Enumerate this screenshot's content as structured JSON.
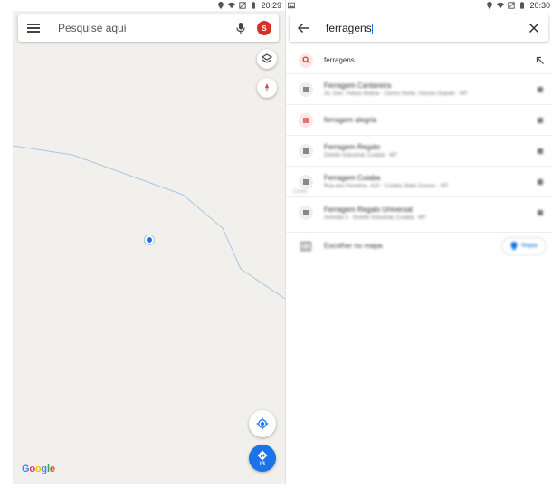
{
  "left_screen": {
    "status_time": "20:29",
    "search_placeholder": "Pesquise aqui",
    "avatar_letter": "S",
    "go_button_label": "IR",
    "google_logo": "Google"
  },
  "right_screen": {
    "status_time": "20:30",
    "search_value": "ferragens",
    "suggestion_query": "ferragens",
    "results": [
      {
        "title": "Ferragem Cantareira",
        "subtitle": "Av. Gen. Felicio Molina · Centro Norte, Várzea Grande · MT",
        "distance": ""
      },
      {
        "title": "ferragem alegria",
        "subtitle": "",
        "distance": ""
      },
      {
        "title": "Ferragem Regalo",
        "subtitle": "Distrito Industrial, Cuiabá · MT",
        "distance": ""
      },
      {
        "title": "Ferragem Cuiaba",
        "subtitle": "Rua dos Ferreiros, 410 · Cuiabá, Mato Grosso · MT",
        "distance": "2,9 km"
      },
      {
        "title": "Ferragem Regalo Universal",
        "subtitle": "Avenida 3 · Distrito Industrial, Cuiabá · MT",
        "distance": ""
      }
    ],
    "choose_on_map_label": "Escolher no mapa",
    "map_chip_label": "Mapa"
  },
  "colors": {
    "accent": "#1a73e8",
    "avatar_bg": "#d93025",
    "map_bg": "#f1f0ec",
    "road": "#a8c7e0"
  }
}
